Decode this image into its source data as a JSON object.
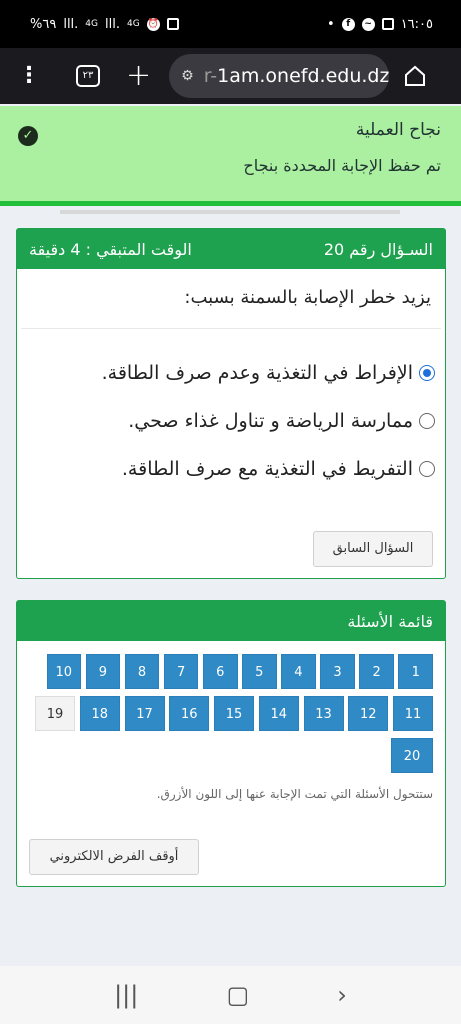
{
  "status_bar": {
    "time": "١٦:٠٥",
    "battery": "%٦٩",
    "signal_left": "4G",
    "signal_right": "4G"
  },
  "browser": {
    "tab_count": "٢٣",
    "url_dim": "r-",
    "url_main": "1am.onefd.edu.dz"
  },
  "notice": {
    "title": "نجاح العملية",
    "message": "تم حفظ الإجابة المحددة بنجاح",
    "colors": {
      "background": "#aaf0a0",
      "border": "#22c03a"
    }
  },
  "question": {
    "number_label": "السـؤال رقم 20",
    "time_left": "الوقت المتبقي : 4 دقيقة",
    "text": "يزيد خطر الإصابة بالسمنة بسبب:",
    "options": [
      {
        "label": "الإفراط في التغذية وعدم صرف الطاقة.",
        "selected": true
      },
      {
        "label": "ممارسة الرياضة و تناول غذاء صحي.",
        "selected": false
      },
      {
        "label": "التفريط في التغذية مع صرف الطاقة.",
        "selected": false
      }
    ],
    "prev_button": "السؤال السابق"
  },
  "question_list": {
    "title": "قائمة الأسئلة",
    "items": [
      {
        "num": "1",
        "answered": true
      },
      {
        "num": "2",
        "answered": true
      },
      {
        "num": "3",
        "answered": true
      },
      {
        "num": "4",
        "answered": true
      },
      {
        "num": "5",
        "answered": true
      },
      {
        "num": "6",
        "answered": true
      },
      {
        "num": "7",
        "answered": true
      },
      {
        "num": "8",
        "answered": true
      },
      {
        "num": "9",
        "answered": true
      },
      {
        "num": "10",
        "answered": true
      },
      {
        "num": "11",
        "answered": true
      },
      {
        "num": "12",
        "answered": true
      },
      {
        "num": "13",
        "answered": true
      },
      {
        "num": "14",
        "answered": true
      },
      {
        "num": "15",
        "answered": true
      },
      {
        "num": "16",
        "answered": true
      },
      {
        "num": "17",
        "answered": true
      },
      {
        "num": "18",
        "answered": true
      },
      {
        "num": "19",
        "answered": false
      },
      {
        "num": "20",
        "answered": true
      }
    ],
    "note": "ستتحول الأسئلة التي تمت الإجابة عنها إلى اللون الأزرق.",
    "stop_button": "أوقف الفرض الالكتروني",
    "colors": {
      "answered": "#2f8ac6",
      "header": "#1fa24f"
    }
  },
  "nav": {
    "recent_icon": "recent-apps-icon",
    "home_icon": "home-circle-icon",
    "back_icon": "back-chevron-icon"
  }
}
